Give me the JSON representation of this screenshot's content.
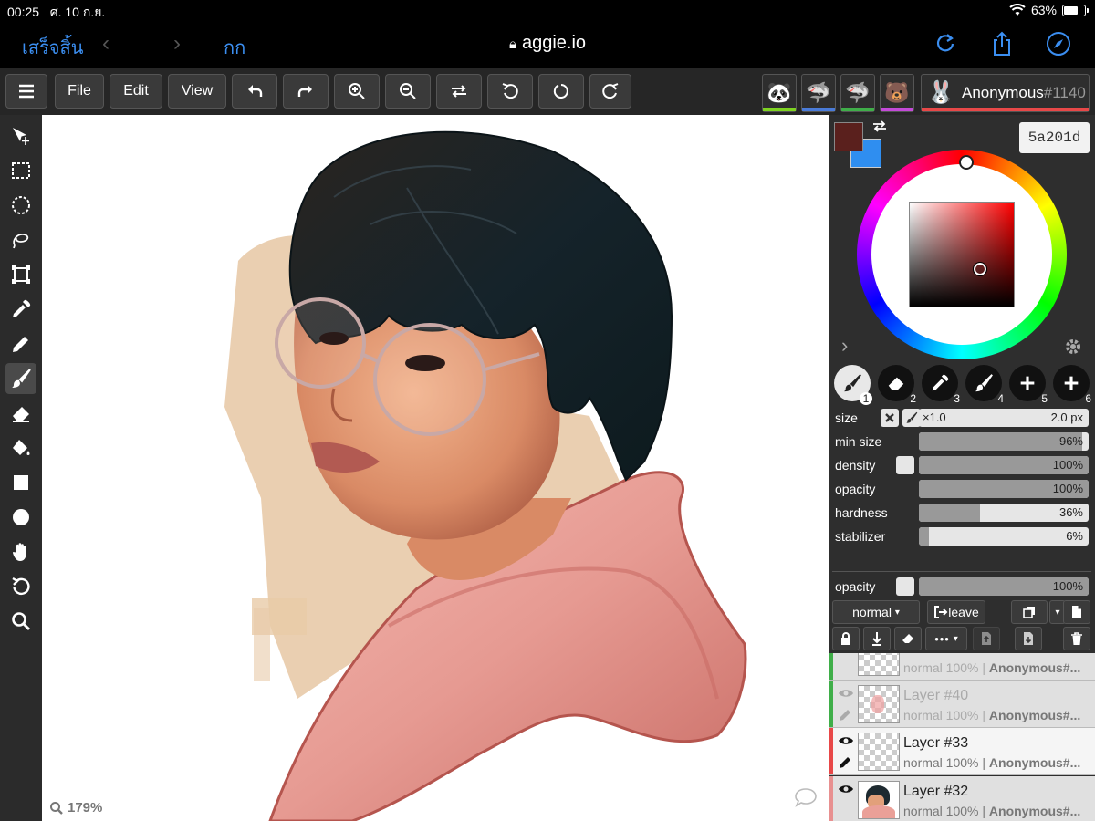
{
  "status": {
    "time": "00:25",
    "date": "ศ. 10 ก.ย.",
    "battery": "63%"
  },
  "browser": {
    "done": "เสร็จสิ้น",
    "text_size": "กก",
    "url": "aggie.io"
  },
  "toolbar": {
    "file": "File",
    "edit": "Edit",
    "view": "View"
  },
  "users": {
    "avatars": [
      {
        "icon": "panda-icon",
        "color": "#7ed321"
      },
      {
        "icon": "shark-icon",
        "color": "#4a7bd8"
      },
      {
        "icon": "shark-icon",
        "color": "#3fae49"
      },
      {
        "icon": "bear-icon",
        "color": "#c44ad8"
      }
    ],
    "current": {
      "name": "Anonymous",
      "number": "#1140",
      "color": "#e84848"
    }
  },
  "canvas": {
    "zoom": "179%"
  },
  "colors": {
    "primary": "#5a201d",
    "secondary": "#2f8ef0",
    "hex": "5a201d"
  },
  "brushes": [
    {
      "number": "1",
      "icon": "brush-icon",
      "active": true
    },
    {
      "number": "2",
      "icon": "eraser-icon",
      "active": false
    },
    {
      "number": "3",
      "icon": "eyedropper-icon",
      "active": false
    },
    {
      "number": "4",
      "icon": "brush-icon",
      "active": false
    },
    {
      "number": "5",
      "icon": "plus-icon",
      "active": false
    },
    {
      "number": "6",
      "icon": "plus-icon",
      "active": false
    }
  ],
  "brush_settings": {
    "size": {
      "label": "size",
      "multiplier": "×1.0",
      "value": "2.0 px"
    },
    "min_size": {
      "label": "min size",
      "value": "96%",
      "level": 0.96
    },
    "density": {
      "label": "density",
      "value": "100%",
      "level": 1.0
    },
    "opacity": {
      "label": "opacity",
      "value": "100%",
      "level": 1.0
    },
    "hardness": {
      "label": "hardness",
      "value": "36%",
      "level": 0.36
    },
    "stabilizer": {
      "label": "stabilizer",
      "value": "6%",
      "level": 0.06
    }
  },
  "layer_settings": {
    "opacity_label": "opacity",
    "opacity_value": "100%",
    "opacity_level": 1.0,
    "blend_mode": "normal",
    "leave": "leave"
  },
  "layers": [
    {
      "name": "",
      "meta": "normal 100% | ",
      "owner": "Anonymous#...",
      "color": "#3fae49"
    },
    {
      "name": "Layer #40",
      "meta": "normal 100% | ",
      "owner": "Anonymous#...",
      "color": "#3fae49"
    },
    {
      "name": "Layer #33",
      "meta": "normal 100% | ",
      "owner": "Anonymous#...",
      "color": "#e84848"
    },
    {
      "name": "Layer #32",
      "meta": "normal 100% | ",
      "owner": "Anonymous#...",
      "color": "#e89090"
    }
  ]
}
